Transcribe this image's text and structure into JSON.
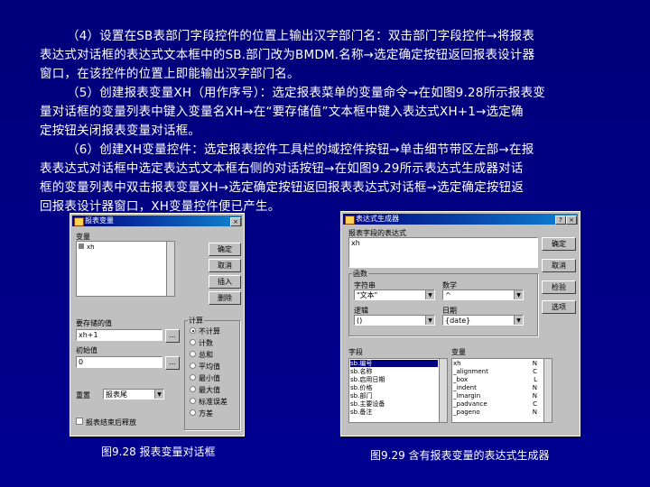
{
  "paragraphs": [
    [
      "（4）设置在SB表部门字段控件的位置上输出汉字部门名：双击部门字段控件→将报表",
      "表达式对话框的表达式文本框中的SB.部门改为BMDM.名称→选定确定按钮返回报表设计器",
      "窗口，在该控件的位置上即能输出汉字部门名。"
    ],
    [
      "（5）创建报表变量XH（用作序号）：选定报表菜单的变量命令→在如图9.28所示报表变",
      "量对话框的变量列表中键入变量名XH→在“要存储值”文本框中键入表达式XH+1→选定确",
      "定按钮关闭报表变量对话框。"
    ],
    [
      "（6）创建XH变量控件：选定报表控件工具栏的域控件按钮→单击细节带区左部→在报",
      "表表达式对话框中选定表达式文本框右侧的对话按钮→在如图9.29所示表达式生成器对话",
      "框的变量列表中双击报表变量XH→选定确定按钮返回报表表达式对话框→选定确定按钮返",
      "回报表设计器窗口，XH变量控件便已产生。"
    ]
  ],
  "captions": {
    "fig28": "图9.28  报表变量对话框",
    "fig29": "图9.29  含有报表变量的表达式生成器"
  },
  "dialog1": {
    "title": "报表变量",
    "variables_label": "变量",
    "variables": [
      "xh"
    ],
    "buttons": [
      "确定",
      "取消",
      "插入",
      "删除"
    ],
    "store_label": "要存储的值",
    "store_value": "xh+1",
    "initial_label": "初始值",
    "initial_value": "0",
    "reset_label": "重置",
    "reset_value": "报表尾",
    "calc_label": "计算",
    "calc_options": [
      "不计算",
      "计数",
      "总和",
      "平均值",
      "最小值",
      "最大值",
      "标准误差",
      "方差"
    ],
    "release_label": "报表结束后释放"
  },
  "dialog2": {
    "title": "表达式生成器",
    "expr_label": "报表字段的表达式",
    "expr_value": "xh",
    "buttons": [
      "确定",
      "取消",
      "检验",
      "选项"
    ],
    "func_label": "函数",
    "string_label": "字符串",
    "string_value": "\"文本\"",
    "math_label": "数学",
    "math_value": "^",
    "logic_label": "逻辑",
    "logic_value": "()",
    "date_label": "日期",
    "date_value": "{date}",
    "fields_label": "字段",
    "fields": [
      "sb.编号",
      "sb.名称",
      "sb.启用日期",
      "sb.价格",
      "sb.部门",
      "sb.主要设备",
      "sb.备注"
    ],
    "vars_label": "变量",
    "vars": [
      [
        "xh",
        "N"
      ],
      [
        "_alignment",
        "C"
      ],
      [
        "_box",
        "L"
      ],
      [
        "_indent",
        "N"
      ],
      [
        "_lmargin",
        "N"
      ],
      [
        "_padvance",
        "C"
      ],
      [
        "_pageno",
        "N"
      ]
    ]
  }
}
